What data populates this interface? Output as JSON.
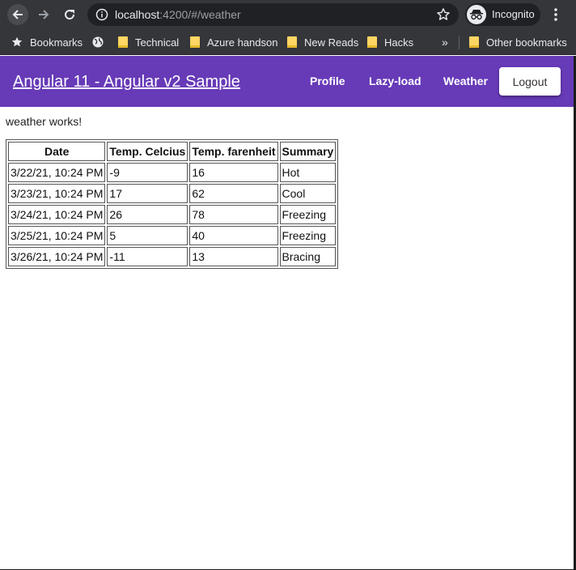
{
  "browser": {
    "url_host": "localhost",
    "url_path": ":4200/#/weather",
    "profile_label": "Incognito",
    "bookmarks": [
      {
        "label": "Bookmarks",
        "icon": "star-icon"
      },
      {
        "label": "",
        "icon": "globe-icon"
      },
      {
        "label": "Technical",
        "icon": "folder-icon"
      },
      {
        "label": "Azure handson",
        "icon": "folder-icon"
      },
      {
        "label": "New Reads",
        "icon": "folder-icon"
      },
      {
        "label": "Hacks",
        "icon": "folder-icon"
      }
    ],
    "overflow_label": "»",
    "other_bookmarks": "Other bookmarks"
  },
  "app": {
    "title": "Angular 11 - Angular v2 Sample",
    "nav": [
      {
        "label": "Profile"
      },
      {
        "label": "Lazy-load"
      },
      {
        "label": "Weather"
      }
    ],
    "logout_label": "Logout",
    "accent_color": "#673ab7"
  },
  "weather": {
    "status": "weather works!",
    "columns": [
      "Date",
      "Temp. Celcius",
      "Temp. farenheit",
      "Summary"
    ],
    "rows": [
      [
        "3/22/21, 10:24 PM",
        "-9",
        "16",
        "Hot"
      ],
      [
        "3/23/21, 10:24 PM",
        "17",
        "62",
        "Cool"
      ],
      [
        "3/24/21, 10:24 PM",
        "26",
        "78",
        "Freezing"
      ],
      [
        "3/25/21, 10:24 PM",
        "5",
        "40",
        "Freezing"
      ],
      [
        "3/26/21, 10:24 PM",
        "-11",
        "13",
        "Bracing"
      ]
    ]
  }
}
